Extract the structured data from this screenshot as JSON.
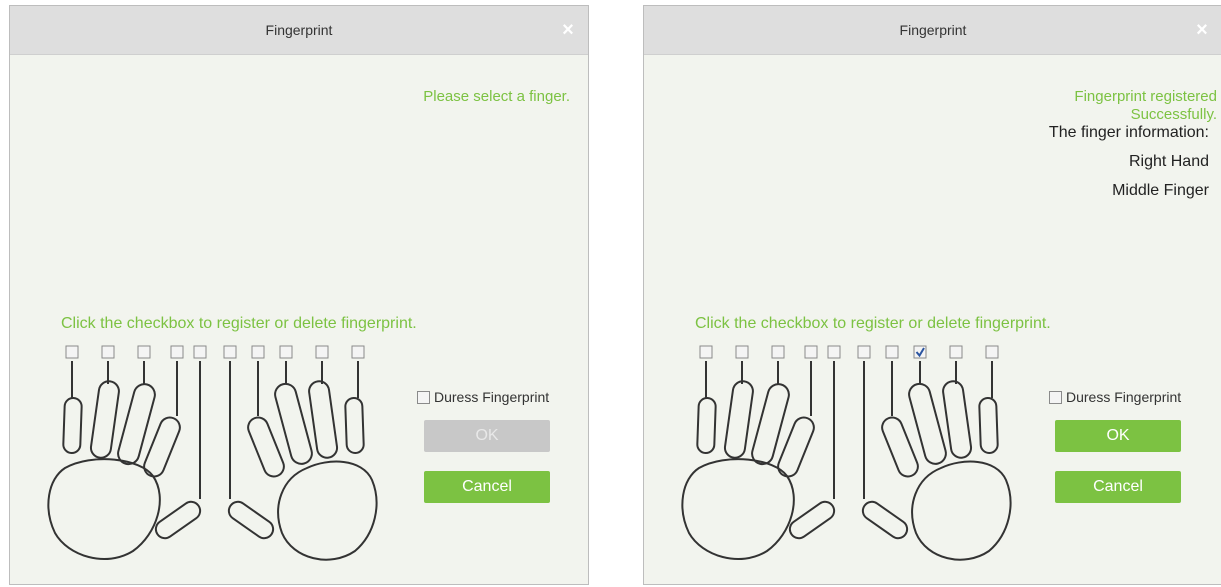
{
  "dialog_left": {
    "title": "Fingerprint",
    "close_symbol": "×",
    "status": "Please select a finger.",
    "instruction": "Click the checkbox to register or delete fingerprint.",
    "duress_label": "Duress Fingerprint",
    "ok_label": "OK",
    "ok_enabled": false,
    "cancel_label": "Cancel",
    "checked_fingers": []
  },
  "dialog_right": {
    "title": "Fingerprint",
    "close_symbol": "×",
    "status_line1": "Fingerprint registered",
    "status_line2": "Successfully.",
    "info_heading": "The finger information:",
    "info_hand": "Right Hand",
    "info_finger": "Middle Finger",
    "instruction": "Click the checkbox to register or delete fingerprint.",
    "duress_label": "Duress Fingerprint",
    "ok_label": "OK",
    "ok_enabled": true,
    "cancel_label": "Cancel",
    "checked_fingers": [
      "right-middle"
    ]
  },
  "colors": {
    "accent_green": "#7cc242",
    "dialog_bg": "#f2f4ee",
    "titlebar_bg": "#dedede",
    "disabled_button": "#c8c8c8",
    "check_mark": "#2b55a0"
  },
  "icons": [
    "close-icon",
    "checkbox-icon",
    "check-mark-icon",
    "left-hand-icon",
    "right-hand-icon"
  ]
}
